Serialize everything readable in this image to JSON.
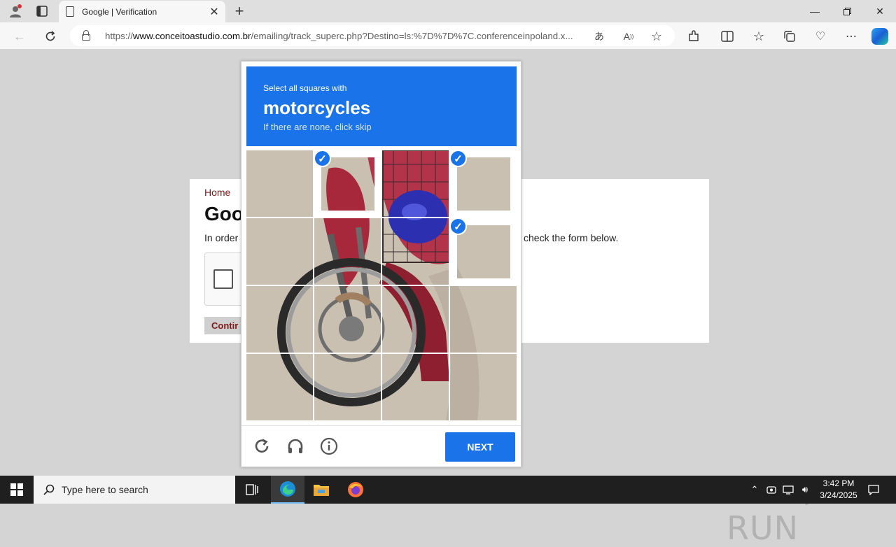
{
  "browser": {
    "tab_title": "Google | Verification",
    "url_prefix": "https://",
    "url_domain": "www.conceitoastudio.com.br",
    "url_path": "/emailing/track_superc.php?Destino=ls:%7D%7D%7C.conferenceinpoland.x..."
  },
  "page": {
    "breadcrumb": "Home",
    "heading": "Goo",
    "intro_left": "In order",
    "intro_right": "check the form below.",
    "continue_label": "Contir"
  },
  "challenge": {
    "instruction": "Select all squares with",
    "target": "motorcycles",
    "hint": "If there are none, click skip",
    "selected_tiles": [
      1,
      3,
      7
    ],
    "next_label": "NEXT"
  },
  "watermark": "ANY ▷ RUN",
  "taskbar": {
    "search_placeholder": "Type here to search",
    "time": "3:42 PM",
    "date": "3/24/2025"
  },
  "colors": {
    "accent": "#1a73e8",
    "brand_red": "#7a1b1b"
  }
}
